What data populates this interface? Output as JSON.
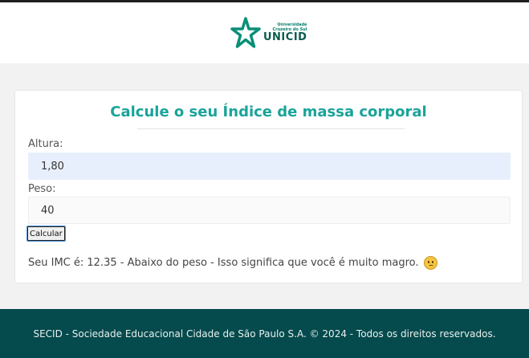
{
  "brand": {
    "university_line1": "Universidade",
    "university_line2": "Cruzeiro do Sul",
    "name": "UNICID",
    "color": "#0a7f6d"
  },
  "form": {
    "title": "Calcule o seu Índice de massa corporal",
    "height_label": "Altura:",
    "height_value": "1,80",
    "weight_label": "Peso:",
    "weight_value": "40",
    "submit_label": "Calcular"
  },
  "result": {
    "text": "Seu IMC é: 12.35 - Abaixo do peso - Isso significa que você é muito magro.",
    "icon": "sad-face-icon"
  },
  "footer": {
    "text": "SECID - Sociedade Educacional Cidade de São Paulo S.A. © 2024 - Todos os direitos reservados.",
    "color": "#054a4d"
  },
  "colors": {
    "accent": "#1aa39a",
    "page_bg": "#f2f2f2"
  }
}
